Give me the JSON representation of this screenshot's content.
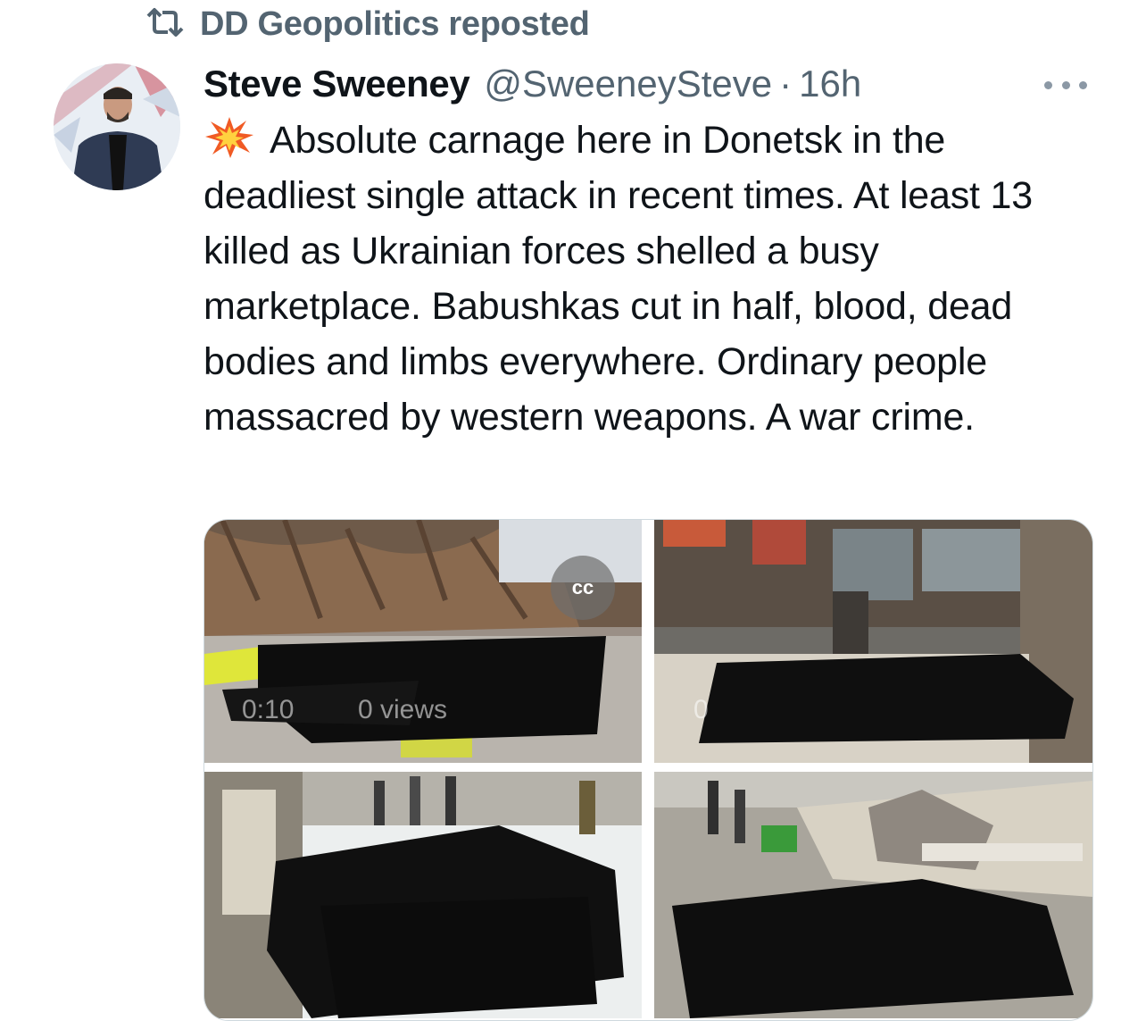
{
  "repost": {
    "label": "DD Geopolitics reposted",
    "icon": "repost-icon"
  },
  "author": {
    "name": "Steve Sweeney",
    "handle": "@SweeneySteve",
    "separator": "·",
    "time": "16h"
  },
  "menu": {
    "icon": "more-options-icon"
  },
  "tweet": {
    "emoji": "collision-emoji",
    "text": "Absolute carnage here in Donetsk in the deadliest single attack in recent times. At least 13 killed as Ukrainian forces shelled a busy marketplace. Babushkas cut in half, blood, dead bodies and limbs everywhere. Ordinary people massacred by western weapons. A war crime."
  },
  "media": {
    "video_tile": {
      "duration": "0:10",
      "views": "0 views",
      "cc_label": "cc"
    },
    "second_tile": {
      "overlay": "0"
    }
  },
  "colors": {
    "text_primary": "#0f1419",
    "text_secondary": "#536471",
    "border": "#cfd9de"
  }
}
